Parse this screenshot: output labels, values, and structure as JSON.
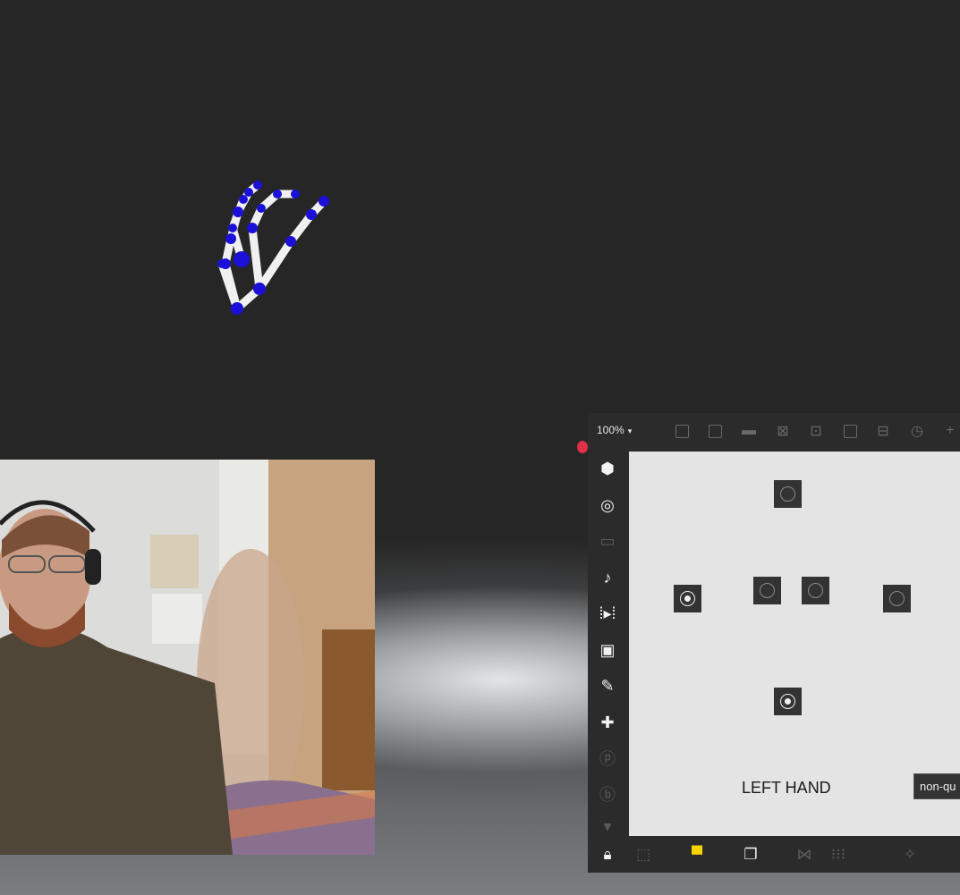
{
  "patcher": {
    "zoom": "100%",
    "zoom_caret": "▾",
    "canvas": {
      "comment": "LEFT HAND",
      "message": "non-qu"
    },
    "toggles": [
      {
        "name": "bang-top",
        "on": false
      },
      {
        "name": "toggle-left",
        "on": true
      },
      {
        "name": "bang-center-left",
        "on": false
      },
      {
        "name": "bang-center-right",
        "on": false
      },
      {
        "name": "bang-right",
        "on": false
      },
      {
        "name": "toggle-bottom",
        "on": true
      }
    ]
  },
  "icons": {
    "top_toolbar": [
      "grid-icon",
      "presentation-icon",
      "comment-icon",
      "close-box-icon",
      "inspector-icon",
      "send-icon",
      "split-icon",
      "help-icon",
      "add-icon"
    ],
    "sidebar": [
      "objects-icon",
      "target-icon",
      "bpatcher-icon",
      "music-note-icon",
      "playback-icon",
      "image-icon",
      "paperclip-icon",
      "plugin-icon",
      "p-icon",
      "b-icon",
      "more-icon"
    ],
    "bottom_toolbar": [
      "lock-icon",
      "select-icon",
      "presentation-icon",
      "layers-icon",
      "grid-snap-icon",
      "grid-icon",
      "wand-icon"
    ]
  },
  "colors": {
    "scene_bg": "#262626",
    "joint": "#1a10d8",
    "bone": "#f2f2f2",
    "canvas": "#e4e4e4",
    "accent_yellow": "#f5d400"
  }
}
